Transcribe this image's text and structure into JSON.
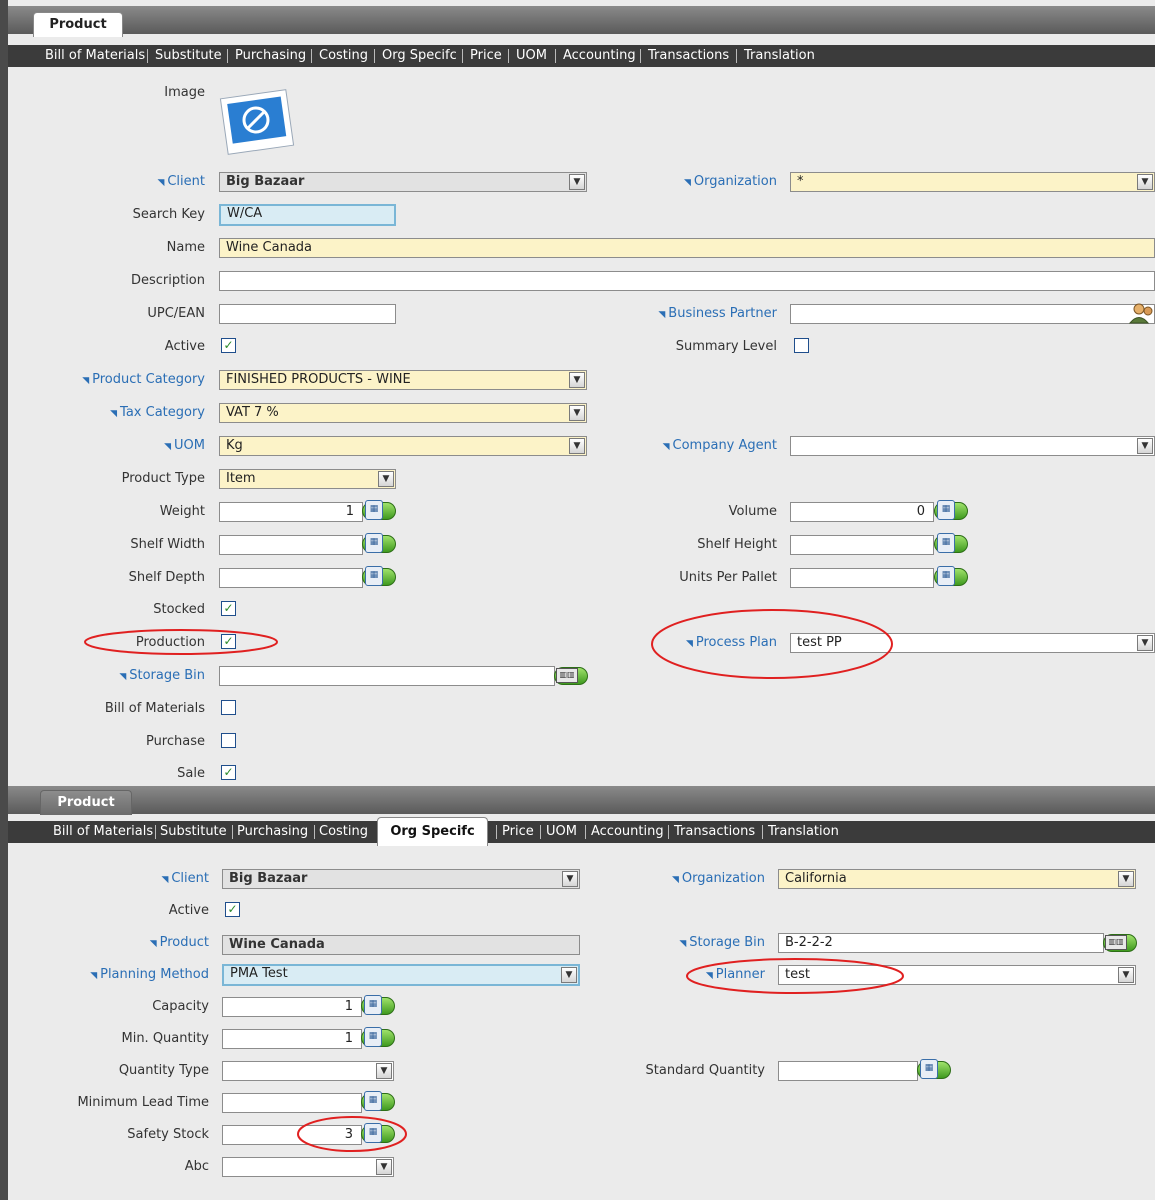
{
  "panel1": {
    "tab_title": "Product",
    "subtabs": [
      "Bill of Materials",
      "Substitute",
      "Purchasing",
      "Costing",
      "Org Specifc",
      "Price",
      "UOM",
      "Accounting",
      "Transactions",
      "Translation"
    ],
    "labels": {
      "image": "Image",
      "client": "Client",
      "organization": "Organization",
      "search_key": "Search Key",
      "name": "Name",
      "description": "Description",
      "upc": "UPC/EAN",
      "business_partner": "Business Partner",
      "active": "Active",
      "summary_level": "Summary Level",
      "product_category": "Product Category",
      "tax_category": "Tax Category",
      "uom": "UOM",
      "company_agent": "Company Agent",
      "product_type": "Product Type",
      "weight": "Weight",
      "volume": "Volume",
      "shelf_width": "Shelf Width",
      "shelf_height": "Shelf Height",
      "shelf_depth": "Shelf Depth",
      "units_per_pallet": "Units Per Pallet",
      "stocked": "Stocked",
      "production": "Production",
      "process_plan": "Process Plan",
      "storage_bin": "Storage Bin",
      "bill_of_materials": "Bill of Materials",
      "purchase": "Purchase",
      "sale": "Sale"
    },
    "values": {
      "client": "Big Bazaar",
      "organization": "*",
      "search_key": "W/CA",
      "name": "Wine Canada",
      "description": "",
      "upc": "",
      "business_partner": "",
      "product_category": "FINISHED PRODUCTS - WINE",
      "tax_category": "VAT 7 %",
      "uom": "Kg",
      "company_agent": "",
      "product_type": "Item",
      "weight": "1",
      "volume": "0",
      "shelf_width": "",
      "shelf_height": "",
      "shelf_depth": "",
      "units_per_pallet": "",
      "process_plan": "test PP",
      "storage_bin": ""
    },
    "checks": {
      "active": true,
      "summary_level": false,
      "stocked": true,
      "production": true,
      "bill_of_materials": false,
      "purchase": false,
      "sale": true
    }
  },
  "panel2": {
    "tab_title": "Product",
    "subtabs": [
      "Bill of Materials",
      "Substitute",
      "Purchasing",
      "Costing",
      "Org Specifc",
      "Price",
      "UOM",
      "Accounting",
      "Transactions",
      "Translation"
    ],
    "active_subtab": "Org Specifc",
    "labels": {
      "client": "Client",
      "organization": "Organization",
      "active": "Active",
      "product": "Product",
      "storage_bin": "Storage Bin",
      "planning_method": "Planning Method",
      "planner": "Planner",
      "capacity": "Capacity",
      "min_quantity": "Min. Quantity",
      "quantity_type": "Quantity Type",
      "standard_quantity": "Standard Quantity",
      "minimum_lead_time": "Minimum Lead Time",
      "safety_stock": "Safety Stock",
      "abc": "Abc"
    },
    "values": {
      "client": "Big Bazaar",
      "organization": "California",
      "product": "Wine Canada",
      "storage_bin": "B-2-2-2",
      "planning_method": "PMA Test",
      "planner": "test",
      "capacity": "1",
      "min_quantity": "1",
      "quantity_type": "",
      "standard_quantity": "",
      "minimum_lead_time": "",
      "safety_stock": "3",
      "abc": ""
    },
    "checks": {
      "active": true
    }
  },
  "colors": {
    "highlight_ellipse": "#e02020",
    "link": "#2a6eb5",
    "required_bg": "#fcf3c8"
  },
  "icons": {
    "dropdown": "chevron-down-icon",
    "calculator": "calculator-icon",
    "locator": "locator-icon",
    "bp_search": "business-partner-icon",
    "no_image": "no-image-icon"
  }
}
